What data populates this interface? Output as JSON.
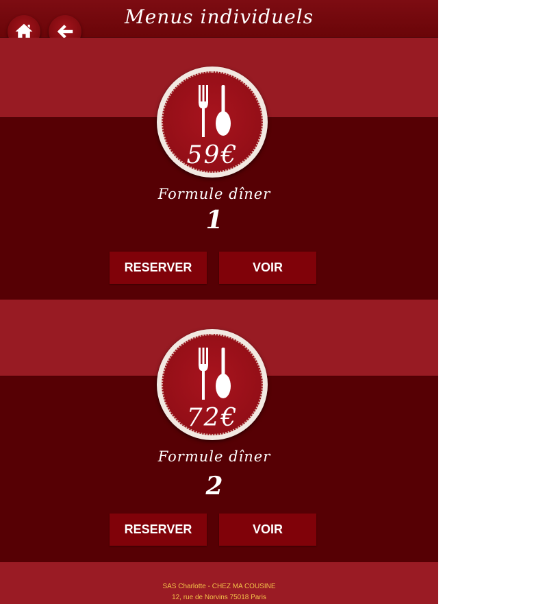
{
  "header": {
    "title": "Menus individuels",
    "home_icon": "home-icon",
    "back_icon": "arrow-left-icon"
  },
  "menus": [
    {
      "price": "59€",
      "label": "Formule dîner",
      "number": "1",
      "reserve_label": "RESERVER",
      "view_label": "VOIR"
    },
    {
      "price": "72€",
      "label": "Formule dîner",
      "number": "2",
      "reserve_label": "RESERVER",
      "view_label": "VOIR"
    }
  ],
  "footer": {
    "line1": "SAS Charlotte - CHEZ MA COUSINE",
    "line2": "12, rue de Norvins 75018 Paris"
  },
  "colors": {
    "header": "#7d0c12",
    "band_light": "#981b23",
    "band_dark": "#560004",
    "button": "#800209",
    "footer_text": "#f4c24a"
  }
}
